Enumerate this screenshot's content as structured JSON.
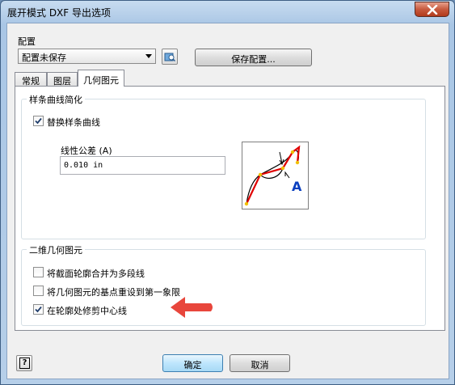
{
  "window": {
    "title": "展开模式 DXF 导出选项"
  },
  "config": {
    "label": "配置",
    "selected": "配置未保存",
    "save_button": "保存配置..."
  },
  "tabs": [
    {
      "label": "常规",
      "active": false
    },
    {
      "label": "图层",
      "active": false
    },
    {
      "label": "几何图元",
      "active": true
    }
  ],
  "spline_group": {
    "caption": "样条曲线简化",
    "replace_checkbox": {
      "label": "替换样条曲线",
      "checked": true
    },
    "tolerance_label": "线性公差 (A)",
    "tolerance_value": "0.010 in",
    "preview_marker": "A"
  },
  "geometry_group": {
    "caption": "二维几何图元",
    "options": [
      {
        "label": "将截面轮廓合并为多段线",
        "checked": false
      },
      {
        "label": "将几何图元的基点重设到第一象限",
        "checked": false
      },
      {
        "label": "在轮廓处修剪中心线",
        "checked": true
      }
    ]
  },
  "footer": {
    "ok": "确定",
    "cancel": "取消",
    "help_icon": "?"
  },
  "colors": {
    "arrow_annotation": "#e8463c",
    "preview_red": "#e00000",
    "preview_yellow": "#f0c000",
    "preview_blue": "#0a3fbf"
  }
}
